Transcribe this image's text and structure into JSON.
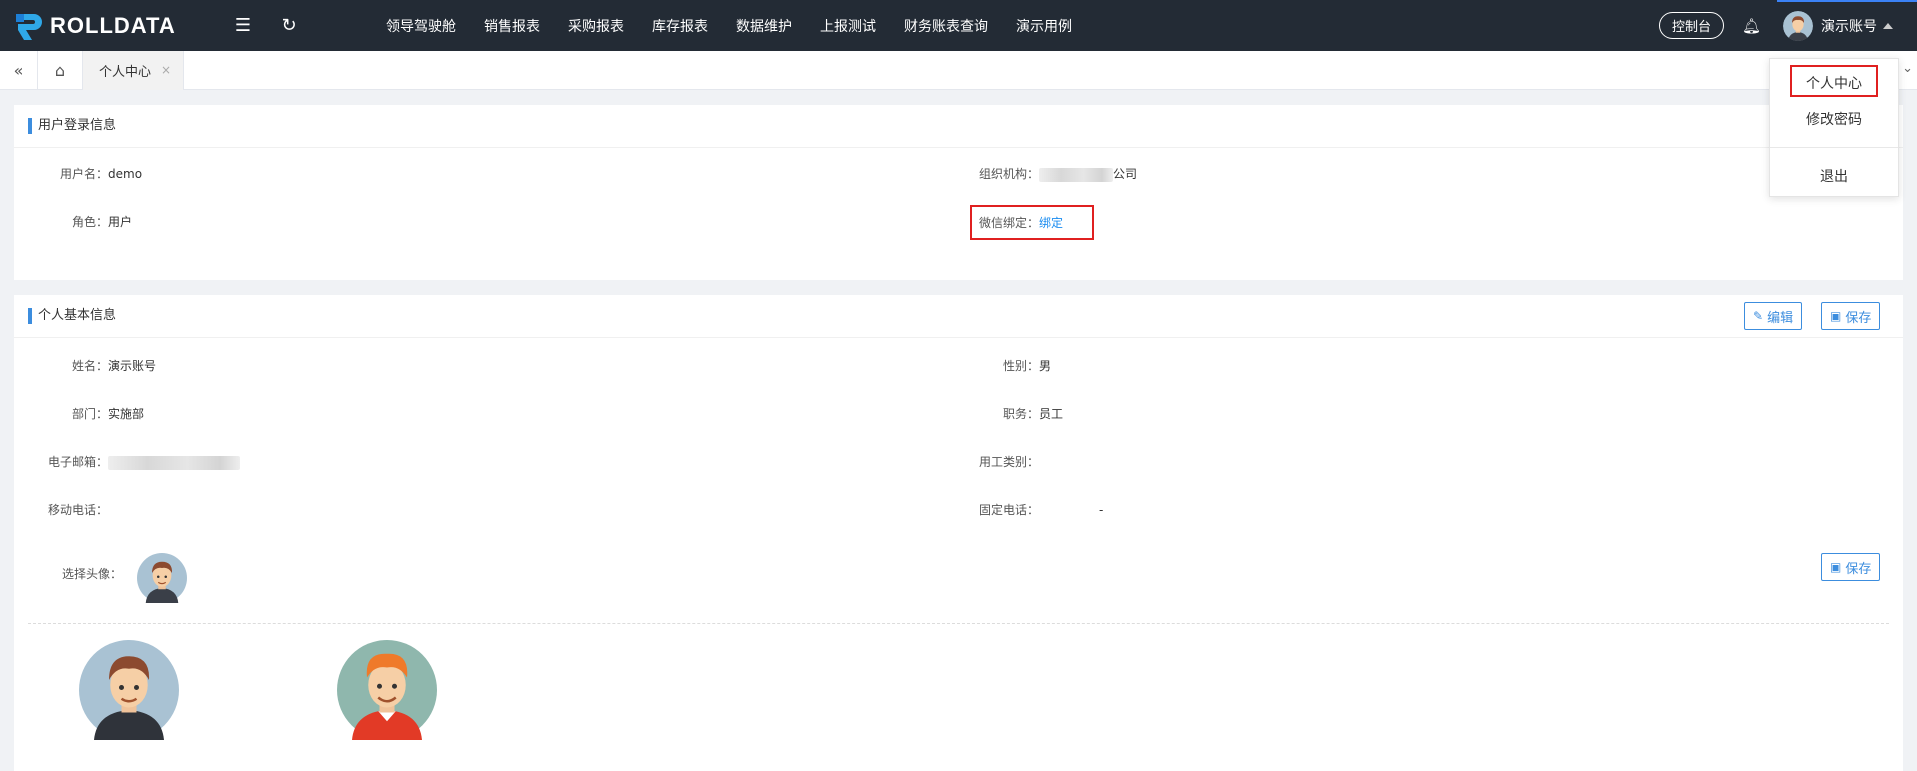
{
  "brand": {
    "name": "ROLLDATA"
  },
  "topnav": {
    "items": [
      "领导驾驶舱",
      "销售报表",
      "采购报表",
      "库存报表",
      "数据维护",
      "上报测试",
      "财务账表查询",
      "演示用例"
    ],
    "console_label": "控制台",
    "user_name": "演示账号"
  },
  "tabs": {
    "active_label": "个人中心",
    "close_glyph": "×"
  },
  "login_info": {
    "title": "用户登录信息",
    "username_label": "用户名：",
    "username_value": "demo",
    "role_label": "角色：",
    "role_value": "用户",
    "org_label": "组织机构：",
    "org_value_suffix": "公司",
    "wechat_label": "微信绑定：",
    "wechat_action": "绑定"
  },
  "basic_info": {
    "title": "个人基本信息",
    "edit_label": "编辑",
    "save_label": "保存",
    "name_label": "姓名：",
    "name_value": "演示账号",
    "gender_label": "性别：",
    "gender_value": "男",
    "dept_label": "部门：",
    "dept_value": "实施部",
    "position_label": "职务：",
    "position_value": "员工",
    "email_label": "电子邮箱：",
    "employment_label": "用工类别：",
    "mobile_label": "移动电话：",
    "phone_label": "固定电话：",
    "phone_value": "-",
    "avatar_label": "选择头像：",
    "avatar_save_label": "保存"
  },
  "user_menu": {
    "items": [
      "个人中心",
      "修改密码",
      "退出"
    ]
  },
  "colors": {
    "topbar": "#232b35",
    "accent": "#3c8dde",
    "link": "#1a8cf0",
    "highlight": "#e02020"
  }
}
